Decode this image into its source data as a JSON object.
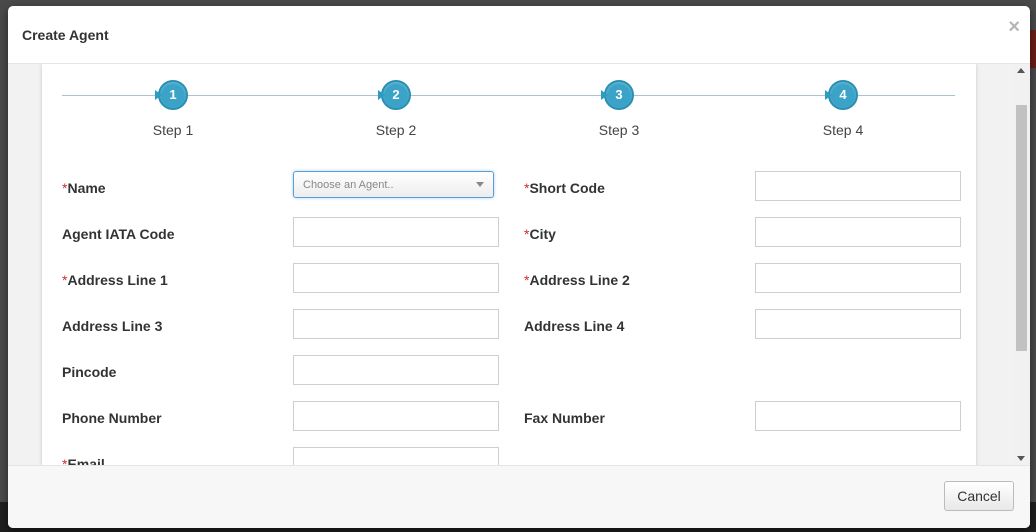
{
  "modal": {
    "title": "Create Agent",
    "close_label": "×"
  },
  "wizard": {
    "steps": [
      {
        "number": "1",
        "label": "Step 1"
      },
      {
        "number": "2",
        "label": "Step 2"
      },
      {
        "number": "3",
        "label": "Step 3"
      },
      {
        "number": "4",
        "label": "Step 4"
      }
    ]
  },
  "form": {
    "required_marker": "*",
    "name": {
      "label": "Name",
      "placeholder": "Choose an Agent.."
    },
    "short_code": {
      "label": "Short Code",
      "value": ""
    },
    "agent_iata_code": {
      "label": "Agent IATA Code",
      "value": ""
    },
    "city": {
      "label": "City",
      "value": ""
    },
    "address_line_1": {
      "label": "Address Line 1",
      "value": ""
    },
    "address_line_2": {
      "label": "Address Line 2",
      "value": ""
    },
    "address_line_3": {
      "label": "Address Line 3",
      "value": ""
    },
    "address_line_4": {
      "label": "Address Line 4",
      "value": ""
    },
    "pincode": {
      "label": "Pincode",
      "value": ""
    },
    "phone_number": {
      "label": "Phone Number",
      "value": ""
    },
    "fax_number": {
      "label": "Fax Number",
      "value": ""
    },
    "email": {
      "label": "Email",
      "value": ""
    }
  },
  "footer": {
    "cancel_label": "Cancel"
  },
  "colors": {
    "step_circle": "#3aa3c7",
    "required_marker": "#c9302c",
    "select_focus_border": "#5b9dd9"
  },
  "icons": {
    "close": "close-icon",
    "dropdown": "chevron-down-icon",
    "step_arrow": "triangle-right-icon"
  }
}
